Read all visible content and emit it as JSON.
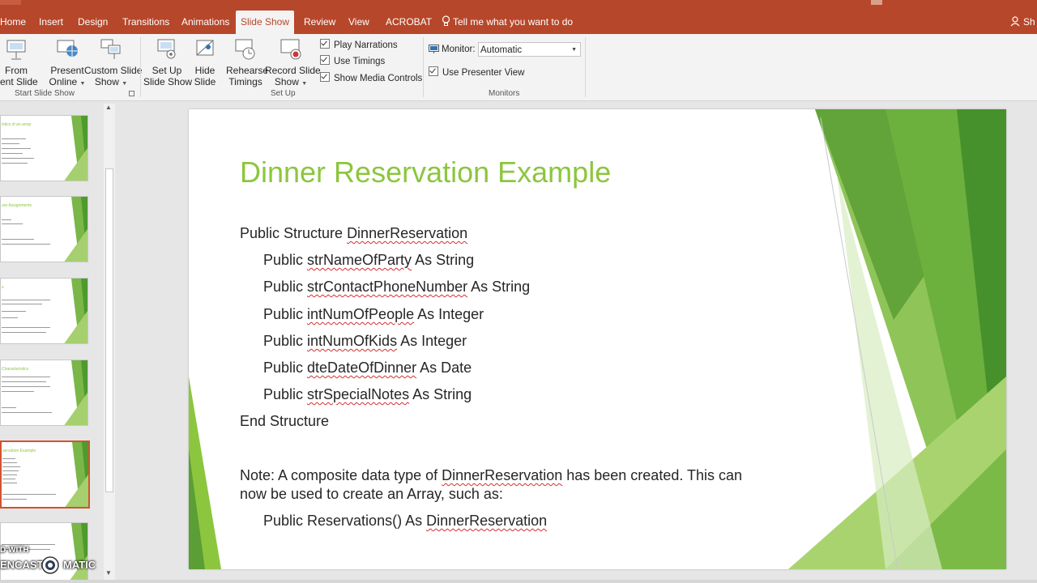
{
  "ribbon_tabs": [
    "Home",
    "Insert",
    "Design",
    "Transitions",
    "Animations",
    "Slide Show",
    "Review",
    "View",
    "ACROBAT"
  ],
  "active_tab": "Slide Show",
  "tell_me": "Tell me what you want to do",
  "user_initials": "Sh",
  "ribbon": {
    "start_group": {
      "label": "Start Slide Show",
      "from_current": [
        "From",
        "rrent Slide"
      ],
      "present_online": [
        "Present",
        "Online"
      ],
      "custom_show": [
        "Custom Slide",
        "Show"
      ]
    },
    "setup_group": {
      "label": "Set Up",
      "setup_show": [
        "Set Up",
        "Slide Show"
      ],
      "hide_slide": [
        "Hide",
        "Slide"
      ],
      "rehearse": [
        "Rehearse",
        "Timings"
      ],
      "record": [
        "Record Slide",
        "Show"
      ],
      "play_narrations": "Play Narrations",
      "use_timings": "Use Timings",
      "show_media_controls": "Show Media Controls"
    },
    "monitors_group": {
      "label": "Monitors",
      "monitor_label": "Monitor:",
      "monitor_value": "Automatic",
      "use_presenter_view": "Use Presenter View"
    }
  },
  "thumbnails": [
    {
      "title": "istics of an array"
    },
    {
      "title": "ure Assignments"
    },
    {
      "title": "s"
    },
    {
      "title": "Characteristics"
    },
    {
      "title": "servation Example"
    },
    {
      "title": ""
    }
  ],
  "slide": {
    "title": "Dinner Reservation Example",
    "line1": {
      "kw": "Public Structure ",
      "name": "DinnerReservation"
    },
    "fields": [
      {
        "kw": "Public ",
        "name": "strNameOfParty",
        "type": " As String"
      },
      {
        "kw": "Public ",
        "name": "strContactPhoneNumber",
        "type": " As String"
      },
      {
        "kw": "Public ",
        "name": "intNumOfPeople",
        "type": " As Integer"
      },
      {
        "kw": "Public ",
        "name": "intNumOfKids",
        "type": " As Integer"
      },
      {
        "kw": "Public ",
        "name": "dteDateOfDinner",
        "type": " As Date"
      },
      {
        "kw": "Public ",
        "name": "strSpecialNotes",
        "type": " As String"
      }
    ],
    "end_line": "End Structure",
    "note_a": "Note: A composite data type of ",
    "note_name": "DinnerReservation",
    "note_b": " has been created. This can",
    "note_line2": "now be used to create an Array, such as:",
    "example_a": "Public Reservations() As ",
    "example_name": "DinnerReservation"
  },
  "watermark": {
    "top": "D WITH",
    "bottom_a": "ENCAST",
    "bottom_b": "MATIC"
  },
  "colors": {
    "accent": "#b7472a",
    "title_green": "#8cc63e"
  }
}
